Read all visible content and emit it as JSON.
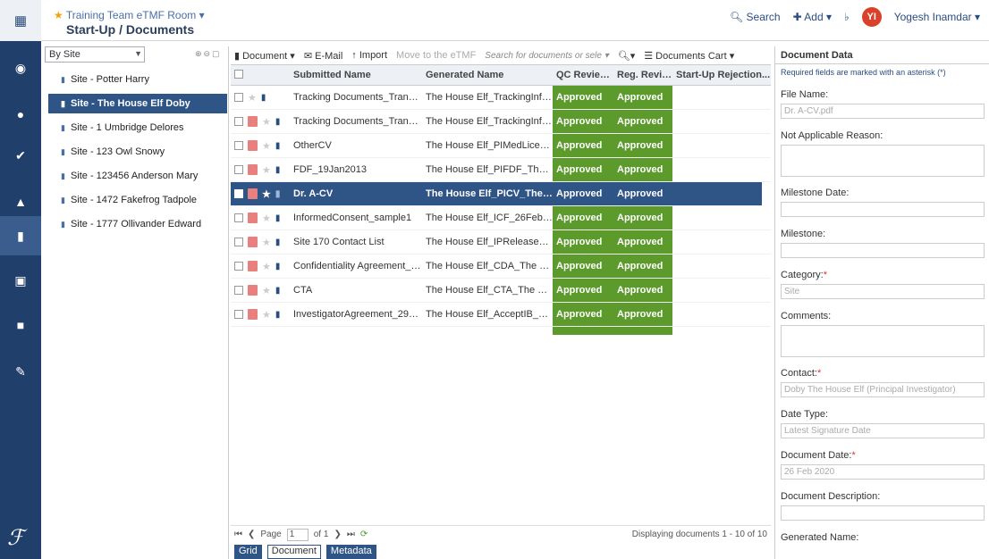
{
  "header": {
    "room_title": "Training Team eTMF Room",
    "breadcrumb": "Start-Up / Documents",
    "search_label": "Search",
    "add_label": "Add",
    "user_initials": "YI",
    "user_name": "Yogesh Inamdar"
  },
  "tree": {
    "filter_value": "By Site",
    "items": [
      {
        "label": "Site - Potter Harry"
      },
      {
        "label": "Site - The House Elf Doby",
        "selected": true
      },
      {
        "label": "Site - 1 Umbridge Delores"
      },
      {
        "label": "Site - 123 Owl Snowy"
      },
      {
        "label": "Site - 123456 Anderson Mary"
      },
      {
        "label": "Site - 1472 Fakefrog Tadpole"
      },
      {
        "label": "Site - 1777 Ollivander Edward"
      }
    ]
  },
  "toolbar": {
    "document": "Document",
    "email": "E-Mail",
    "import": "Import",
    "move": "Move to the eTMF",
    "search_placeholder": "Search for documents or sele",
    "cart": "Documents Cart"
  },
  "table": {
    "headers": [
      "Submitted Name",
      "Generated Name",
      "QC Review ...",
      "Reg. Revie...",
      "Start-Up Rejection..."
    ],
    "rows": [
      {
        "submitted": "Tracking Documents_Transmitta...",
        "generated": "The House Elf_TrackingInfo_28...",
        "qc": "Approved",
        "reg": "Approved"
      },
      {
        "submitted": "Tracking Documents_Transmitta...",
        "generated": "The House Elf_TrackingInfo_26...",
        "qc": "Approved",
        "reg": "Approved"
      },
      {
        "submitted": "OtherCV",
        "generated": "The House Elf_PIMedLicense_...",
        "qc": "Approved",
        "reg": "Approved"
      },
      {
        "submitted": "FDF_19Jan2013",
        "generated": "The House Elf_PIFDF_The Hou...",
        "qc": "Approved",
        "reg": "Approved"
      },
      {
        "submitted": "Dr. A-CV",
        "generated": "The House Elf_PICV_The Hous...",
        "qc": "Approved",
        "reg": "Approved",
        "selected": true
      },
      {
        "submitted": "InformedConsent_sample1",
        "generated": "The House Elf_ICF_26Feb2020",
        "qc": "Approved",
        "reg": "Approved"
      },
      {
        "submitted": "Site 170 Contact List",
        "generated": "The House Elf_IPReleaseDoc_...",
        "qc": "Approved",
        "reg": "Approved"
      },
      {
        "submitted": "Confidentiality Agreement_pdf-r",
        "generated": "The House Elf_CDA_The Hous...",
        "qc": "Approved",
        "reg": "Approved"
      },
      {
        "submitted": "CTA",
        "generated": "The House Elf_CTA_The House...",
        "qc": "Approved",
        "reg": "Approved"
      },
      {
        "submitted": "InvestigatorAgreement_29Sep2...",
        "generated": "The House Elf_AcceptIB_The H...",
        "qc": "Approved",
        "reg": "Approved"
      }
    ]
  },
  "pager": {
    "page_label": "Page",
    "page_value": "1",
    "of_label": "of 1",
    "display_text": "Displaying documents 1 - 10 of 10"
  },
  "tabs": [
    "Grid",
    "Document",
    "Metadata"
  ],
  "meta": {
    "title": "Document Data",
    "required_note": "Required fields are marked with an asterisk (*)",
    "fields": {
      "file_name_label": "File Name:",
      "file_name_value": "Dr. A-CV.pdf",
      "na_reason_label": "Not Applicable Reason:",
      "milestone_date_label": "Milestone Date:",
      "milestone_label": "Milestone:",
      "category_label": "Category:",
      "category_value": "Site",
      "comments_label": "Comments:",
      "contact_label": "Contact:",
      "contact_value": "Doby The House Elf (Principal Investigator)",
      "date_type_label": "Date Type:",
      "date_type_value": "Latest Signature Date",
      "document_date_label": "Document Date:",
      "document_date_value": "26 Feb 2020",
      "description_label": "Document Description:",
      "generated_name_label": "Generated Name:"
    }
  },
  "colors": {
    "accent": "#2f5486",
    "nav": "#213f6b",
    "approved": "#5b9a2b"
  }
}
